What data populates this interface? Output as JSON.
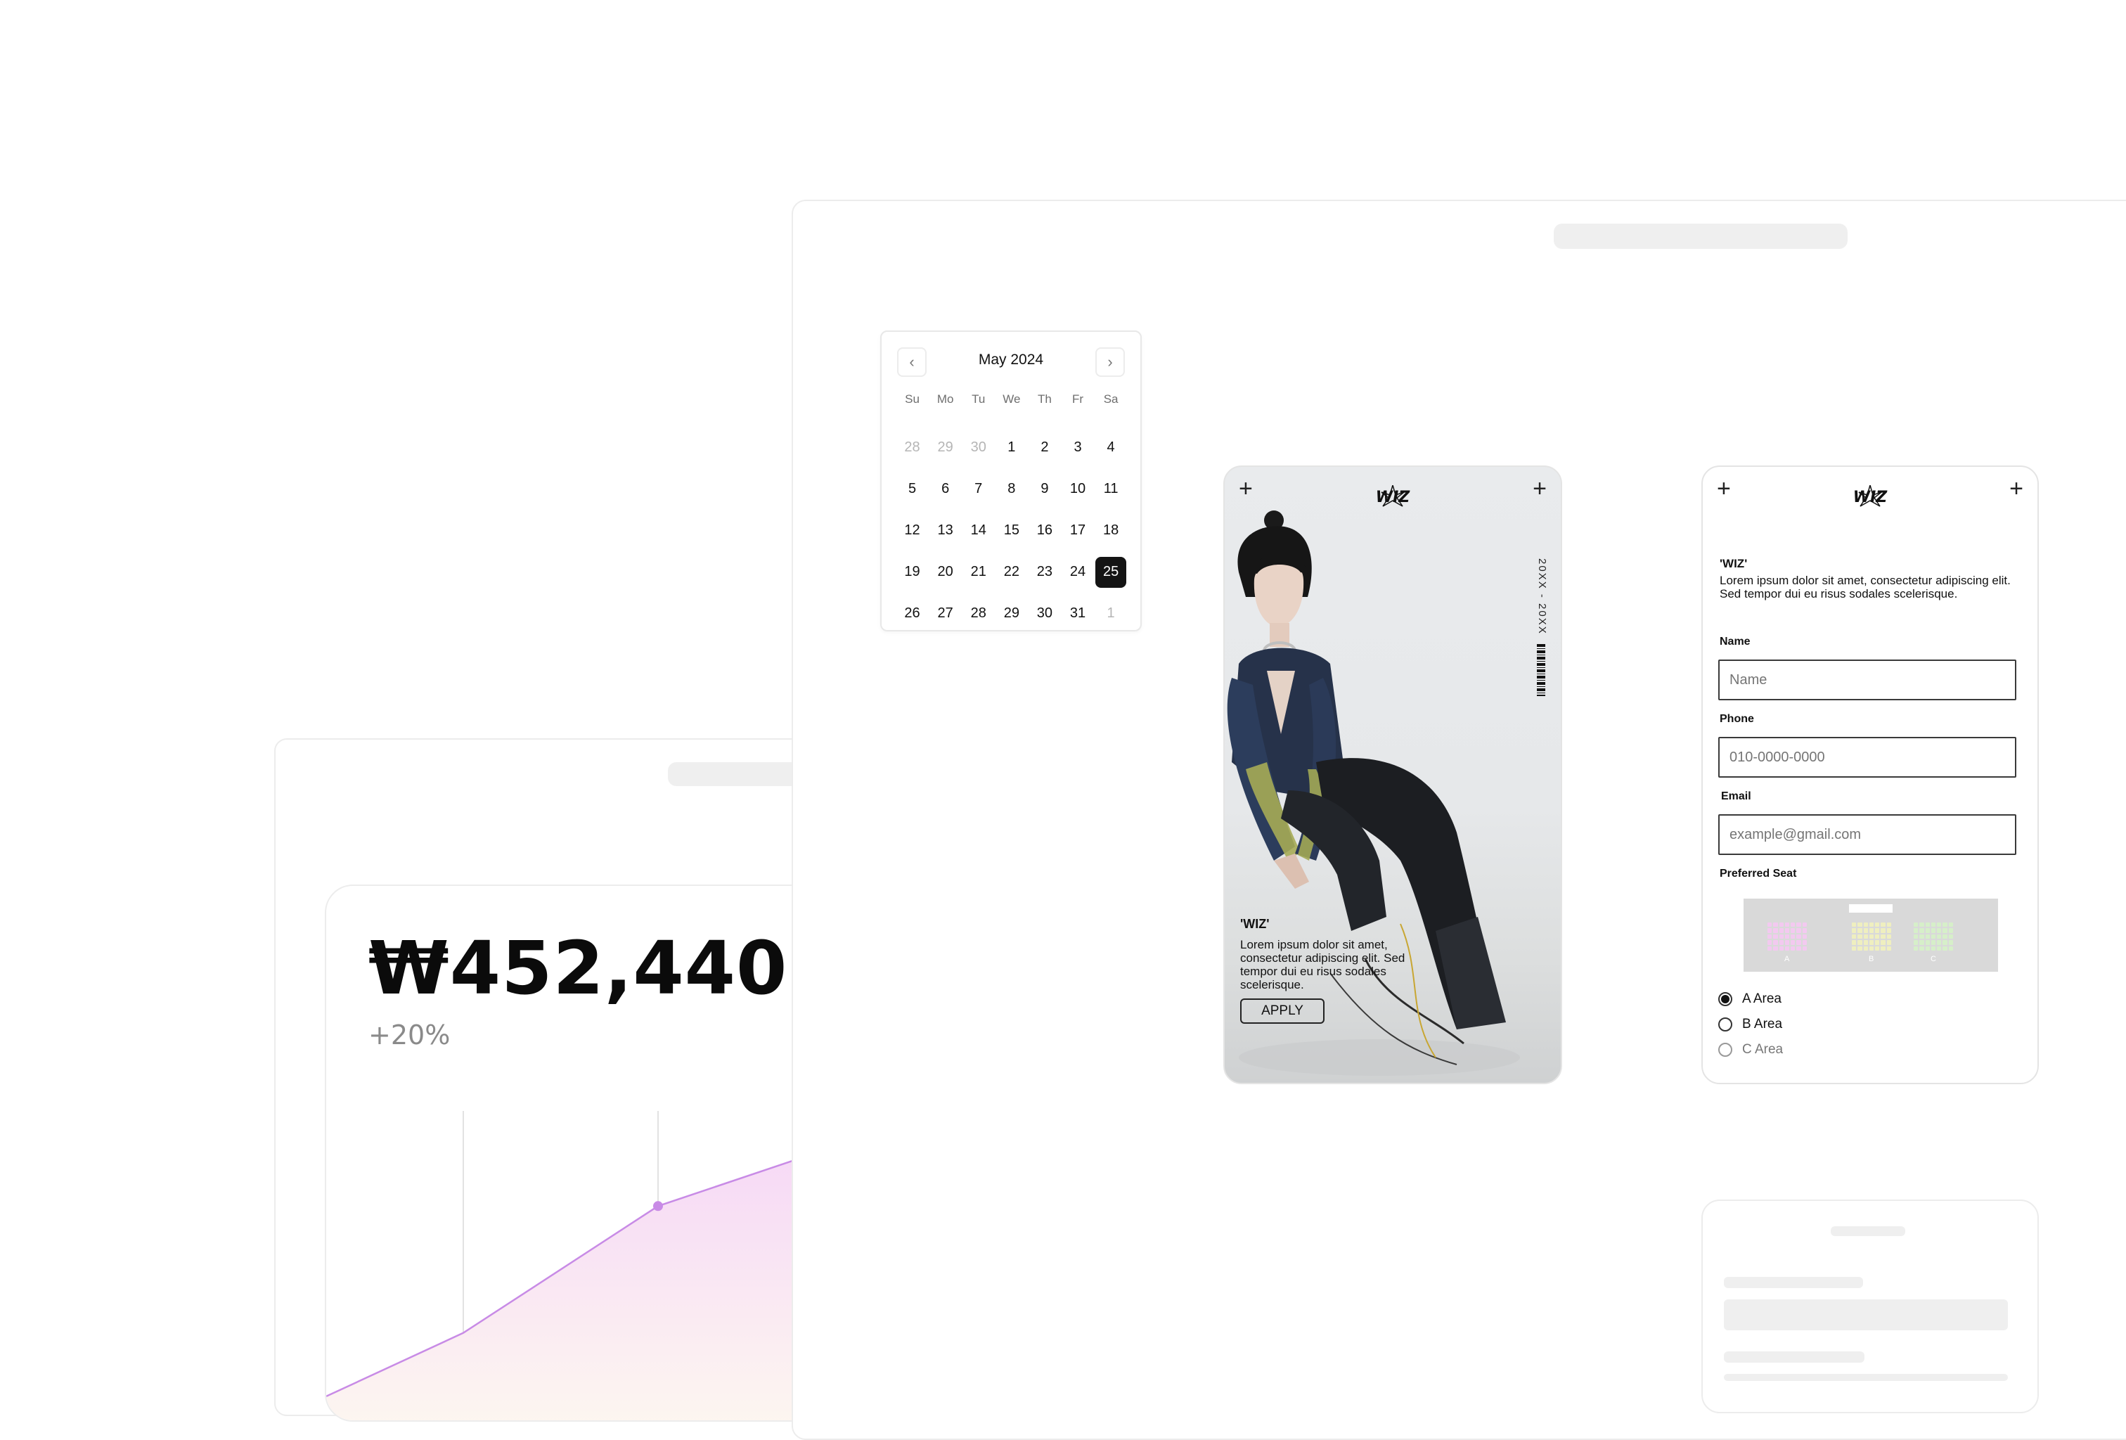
{
  "stat_card": {
    "value": "₩452,440",
    "change": "+20%",
    "accent_color": "#c88be6"
  },
  "chart_data": {
    "type": "area",
    "x": [
      0,
      1,
      2,
      3
    ],
    "values": [
      0,
      1,
      3,
      4
    ],
    "series": [
      {
        "values": [
          0,
          1,
          3,
          4
        ]
      }
    ],
    "highlight_index": 2,
    "grid": true
  },
  "calendar": {
    "title": "May 2024",
    "prev_icon": "chevron-left-icon",
    "next_icon": "chevron-right-icon",
    "weekdays": [
      "Su",
      "Mo",
      "Tu",
      "We",
      "Th",
      "Fr",
      "Sa"
    ],
    "days": [
      {
        "d": "28",
        "muted": true
      },
      {
        "d": "29",
        "muted": true
      },
      {
        "d": "30",
        "muted": true
      },
      {
        "d": "1"
      },
      {
        "d": "2"
      },
      {
        "d": "3"
      },
      {
        "d": "4"
      },
      {
        "d": "5"
      },
      {
        "d": "6"
      },
      {
        "d": "7"
      },
      {
        "d": "8"
      },
      {
        "d": "9"
      },
      {
        "d": "10"
      },
      {
        "d": "11"
      },
      {
        "d": "12"
      },
      {
        "d": "13"
      },
      {
        "d": "14"
      },
      {
        "d": "15"
      },
      {
        "d": "16"
      },
      {
        "d": "17"
      },
      {
        "d": "18"
      },
      {
        "d": "19"
      },
      {
        "d": "20"
      },
      {
        "d": "21"
      },
      {
        "d": "22"
      },
      {
        "d": "23"
      },
      {
        "d": "24"
      },
      {
        "d": "25",
        "selected": true
      },
      {
        "d": "26"
      },
      {
        "d": "27"
      },
      {
        "d": "28"
      },
      {
        "d": "29"
      },
      {
        "d": "30"
      },
      {
        "d": "31"
      },
      {
        "d": "1",
        "muted": true
      }
    ]
  },
  "poster": {
    "logo": "WIZ",
    "plus": "+",
    "date_range": "20XX - 20XX",
    "title": "'WIZ'",
    "body": "Lorem ipsum dolor sit amet, consectetur adipiscing elit. Sed tempor dui eu risus sodales scelerisque.",
    "apply_label": "APPLY"
  },
  "form": {
    "logo": "WIZ",
    "plus": "+",
    "title": "'WIZ'",
    "body": "Lorem ipsum dolor sit amet, consectetur adipiscing elit. Sed tempor dui eu risus sodales scelerisque.",
    "name_label": "Name",
    "name_placeholder": "Name",
    "phone_label": "Phone",
    "phone_placeholder": "010-0000-0000",
    "email_label": "Email",
    "email_placeholder": "example@gmail.com",
    "seat_label": "Preferred Seat",
    "seat_sections": [
      "A",
      "B",
      "C"
    ],
    "seat_colors": [
      "#f3c9f0",
      "#efefbf",
      "#d6efc9"
    ],
    "options": [
      {
        "label": "A Area",
        "checked": true
      },
      {
        "label": "B Area",
        "checked": false
      },
      {
        "label": "C Area",
        "checked": false
      }
    ]
  }
}
